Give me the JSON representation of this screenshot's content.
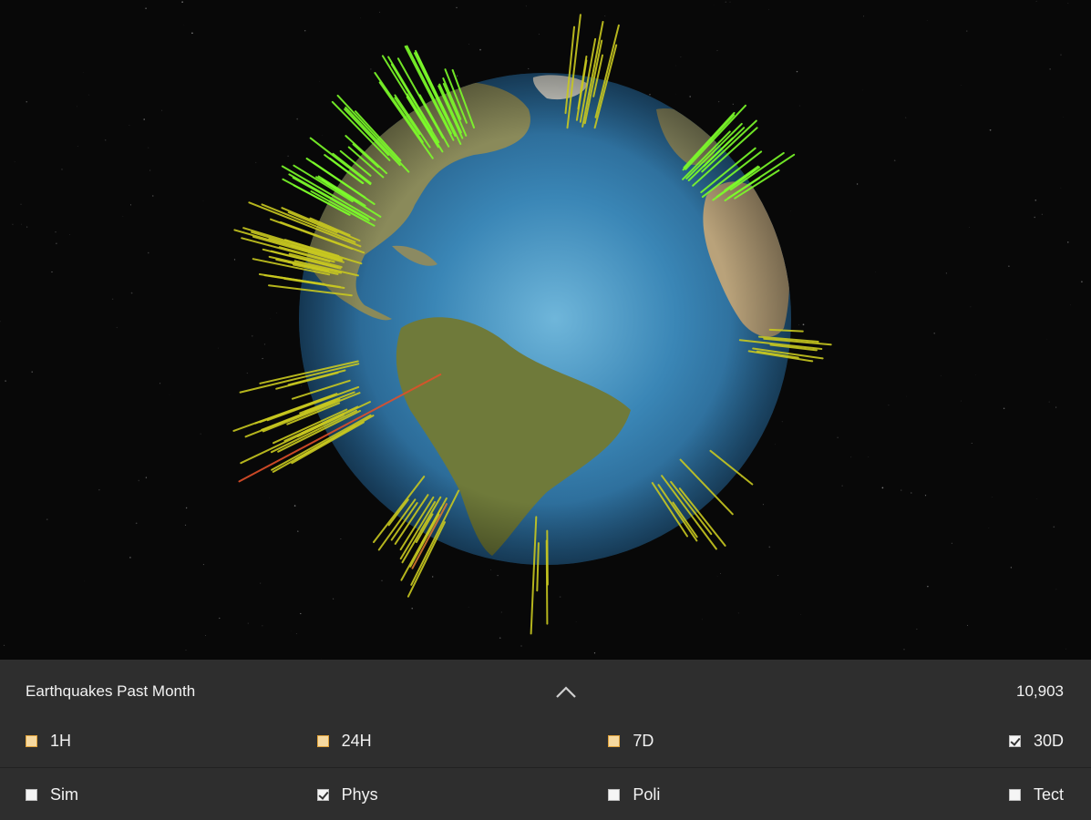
{
  "panel": {
    "title": "Earthquakes Past Month",
    "count": "10,903",
    "toggle_icon": "chevron-up-icon"
  },
  "time_filters": [
    {
      "label": "1H",
      "checked": false
    },
    {
      "label": "24H",
      "checked": false
    },
    {
      "label": "7D",
      "checked": false
    },
    {
      "label": "30D",
      "checked": true
    }
  ],
  "layer_filters": [
    {
      "label": "Sim",
      "checked": false
    },
    {
      "label": "Phys",
      "checked": true
    },
    {
      "label": "Poli",
      "checked": false
    },
    {
      "label": "Tect",
      "checked": false
    }
  ],
  "colors": {
    "panel_bg": "#2e2e2e",
    "ocean": "#2f6f9e",
    "quake_low": "#7cfc2a",
    "quake_mid": "#c8c820",
    "quake_high": "#e0502a"
  }
}
